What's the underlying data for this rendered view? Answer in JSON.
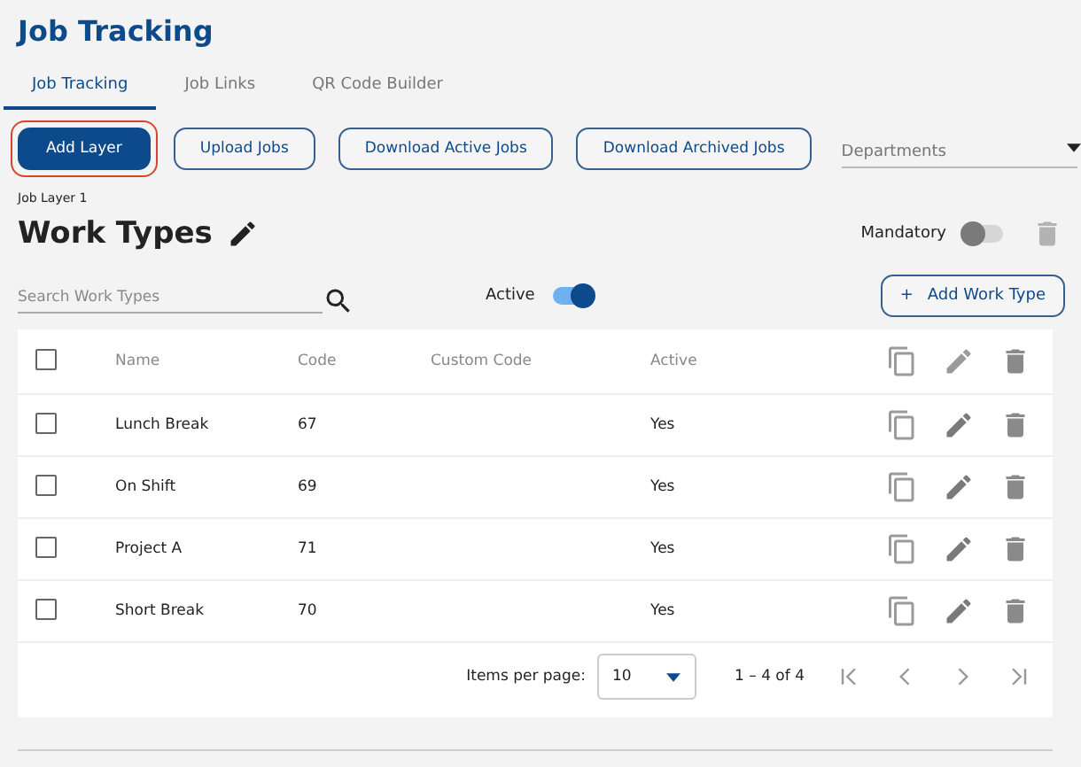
{
  "title": "Job Tracking",
  "tabs": [
    {
      "label": "Job Tracking",
      "selected": true
    },
    {
      "label": "Job Links",
      "selected": false
    },
    {
      "label": "QR Code Builder",
      "selected": false
    }
  ],
  "actions": [
    {
      "label": "Add Layer",
      "kind": "primary",
      "focused": true
    },
    {
      "label": "Upload Jobs",
      "kind": "outline",
      "focused": false
    },
    {
      "label": "Download Active Jobs",
      "kind": "outline",
      "focused": false
    },
    {
      "label": "Download Archived Jobs",
      "kind": "outline",
      "focused": false
    }
  ],
  "departments": {
    "placeholder": "Departments"
  },
  "layer_label": "Job Layer 1",
  "heading": "Work Types",
  "mandatory": {
    "label": "Mandatory",
    "on": false
  },
  "search": {
    "placeholder": "Search Work Types"
  },
  "active_filter": {
    "label": "Active",
    "on": true
  },
  "add_button": {
    "icon": "+",
    "label": "Add Work Type"
  },
  "table": {
    "select_all": {
      "checked": false
    },
    "columns": [
      "Name",
      "Code",
      "Custom Code",
      "Active"
    ],
    "rows": [
      {
        "checked": false,
        "cells": [
          "Lunch Break",
          "67",
          "",
          "Yes"
        ]
      },
      {
        "checked": false,
        "cells": [
          "On Shift",
          "69",
          "",
          "Yes"
        ]
      },
      {
        "checked": false,
        "cells": [
          "Project A",
          "71",
          "",
          "Yes"
        ]
      },
      {
        "checked": false,
        "cells": [
          "Short Break",
          "70",
          "",
          "Yes"
        ]
      }
    ]
  },
  "pagination": {
    "label": "Items per page:",
    "page_size": "10",
    "range": "1 – 4 of 4"
  }
}
